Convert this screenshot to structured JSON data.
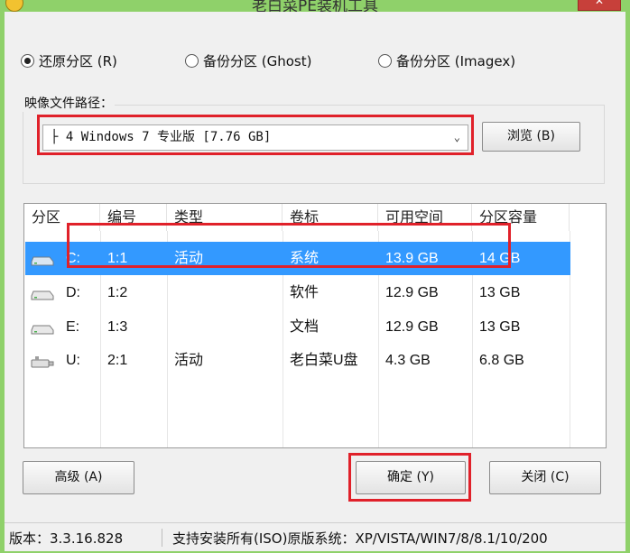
{
  "window": {
    "title": "老白菜PE装机工具"
  },
  "options": [
    {
      "label": "还原分区 (R)",
      "checked": true
    },
    {
      "label": "备份分区 (Ghost)",
      "checked": false
    },
    {
      "label": "备份分区 (Imagex)",
      "checked": false
    }
  ],
  "image_path": {
    "label": "映像文件路径：",
    "selected": "├ 4 Windows 7 专业版 [7.76 GB]",
    "browse_label": "浏览 (B)"
  },
  "table": {
    "headers": [
      "分区",
      "编号",
      "类型",
      "卷标",
      "可用空间",
      "分区容量"
    ],
    "rows": [
      {
        "drive": "C:",
        "number": "1:1",
        "type": "活动",
        "label": "系统",
        "free": "13.9 GB",
        "capacity": "14 GB",
        "selected": true,
        "icon": "hard-disk-icon"
      },
      {
        "drive": "D:",
        "number": "1:2",
        "type": "",
        "label": "软件",
        "free": "12.9 GB",
        "capacity": "13 GB",
        "selected": false,
        "icon": "hard-disk-icon"
      },
      {
        "drive": "E:",
        "number": "1:3",
        "type": "",
        "label": "文档",
        "free": "12.9 GB",
        "capacity": "13 GB",
        "selected": false,
        "icon": "hard-disk-icon"
      },
      {
        "drive": "U:",
        "number": "2:1",
        "type": "活动",
        "label": "老白菜U盘",
        "free": "4.3 GB",
        "capacity": "6.8 GB",
        "selected": false,
        "icon": "usb-drive-icon"
      }
    ]
  },
  "buttons": {
    "advanced": "高级 (A)",
    "ok": "确定 (Y)",
    "close": "关闭 (C)"
  },
  "status": {
    "version": "版本：3.3.16.828",
    "support": "支持安装所有(ISO)原版系统：XP/VISTA/WIN7/8/8.1/10/200"
  },
  "colors": {
    "frame": "#8fd16a",
    "selection": "#3399ff",
    "highlight_box": "#e0212a"
  }
}
